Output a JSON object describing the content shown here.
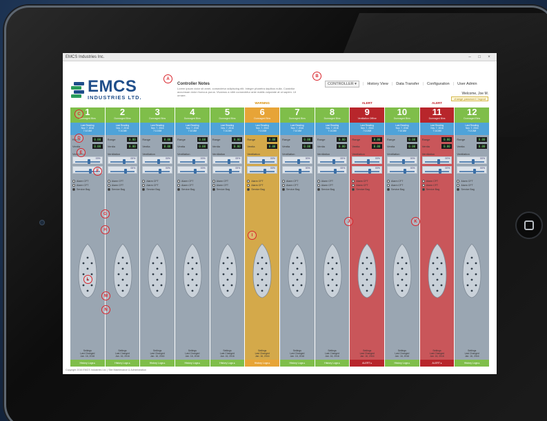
{
  "window": {
    "title": "EMCS Industries Inc.",
    "controls": [
      "–",
      "□",
      "×"
    ]
  },
  "logo": {
    "main": "EMCS",
    "sub": "INDUSTRIES LTD."
  },
  "notes": {
    "title": "Controller Notes",
    "body": "Lorem ipsum dolor sit amet, consectetur adipiscing elit. Integer pharetra dapibus nulla. Curabitur accumsan dolor rhoncus purus. Vivamus a nibh consectetur ante mattis vulputate at ut sapien. Ut ornare."
  },
  "nav": {
    "controller": "CONTROLLER ▾",
    "items": [
      "History View",
      "Data Transfer",
      "Configuration",
      "User Admin"
    ]
  },
  "user": {
    "welcome": "Welcome, Joe M.",
    "logout": "change password / logout"
  },
  "markers": [
    "A",
    "B",
    "C",
    "D",
    "E",
    "F",
    "G",
    "H",
    "I",
    "J",
    "K",
    "L",
    "M",
    "N"
  ],
  "labels": {
    "status_line": "Dunnaged Bins",
    "reading": "Last Reading\nNov. 7, 2016\n7:14 AM",
    "range": "Range",
    "ventia": "Ventia",
    "ventilation": "Ventilation",
    "radios": [
      "Alarm CFT",
      "Alarm CFT",
      "Service Bag"
    ],
    "footer_text": "Settings\nLast Changed\nJan. 16, 2016",
    "footer_btn": "History Logs ▸",
    "alert_btn": "ALERT ▸"
  },
  "channels": [
    {
      "num": "1",
      "status": "Dunnaged Bins",
      "state": "normal",
      "banner": "",
      "v1": "0.00",
      "v2": "0.00",
      "s1": "00%",
      "s2": "00%",
      "fill1": 0.55,
      "fill2": 0.6
    },
    {
      "num": "2",
      "status": "Dunnaged Bins",
      "state": "normal",
      "banner": "",
      "v1": "0.00",
      "v2": "0.00",
      "s1": "00%",
      "s2": "00%",
      "fill1": 0.55,
      "fill2": 0.6
    },
    {
      "num": "3",
      "status": "Dunnaged Bins",
      "state": "normal",
      "banner": "",
      "v1": "0.00",
      "v2": "0.00",
      "s1": "00%",
      "s2": "00%",
      "fill1": 0.55,
      "fill2": 0.6
    },
    {
      "num": "4",
      "status": "Dunnaged Bins",
      "state": "normal",
      "banner": "",
      "v1": "0.00",
      "v2": "0.00",
      "s1": "00%",
      "s2": "00%",
      "fill1": 0.55,
      "fill2": 0.6
    },
    {
      "num": "5",
      "status": "Dunnaged Bins",
      "state": "normal",
      "banner": "",
      "v1": "0.00",
      "v2": "0.00",
      "s1": "00%",
      "s2": "00%",
      "fill1": 0.55,
      "fill2": 0.6
    },
    {
      "num": "6",
      "status": "Dunnaged Bins",
      "state": "warn",
      "banner": "WARNING",
      "v1": "0.00",
      "v2": "0.00",
      "s1": "00%",
      "s2": "00%",
      "fill1": 0.55,
      "fill2": 0.6
    },
    {
      "num": "7",
      "status": "Dunnaged Bins",
      "state": "normal",
      "banner": "",
      "v1": "0.00",
      "v2": "0.00",
      "s1": "00%",
      "s2": "00%",
      "fill1": 0.55,
      "fill2": 0.6
    },
    {
      "num": "8",
      "status": "Dunnaged Bins",
      "state": "normal",
      "banner": "",
      "v1": "0.00",
      "v2": "0.00",
      "s1": "00%",
      "s2": "00%",
      "fill1": 0.55,
      "fill2": 0.6
    },
    {
      "num": "9",
      "status": "Ventilation Offline",
      "state": "alert",
      "banner": "ALERT",
      "v1": "0.00",
      "v2": "0.00",
      "s1": "00%",
      "s2": "00%",
      "fill1": 0.55,
      "fill2": 0.6
    },
    {
      "num": "10",
      "status": "Dunnaged Bins",
      "state": "normal",
      "banner": "",
      "v1": "0.00",
      "v2": "0.00",
      "s1": "00%",
      "s2": "00%",
      "fill1": 0.55,
      "fill2": 0.6
    },
    {
      "num": "11",
      "status": "Dunnaged Bins",
      "state": "alert",
      "banner": "ALERT",
      "v1": "0.00",
      "v2": "0.00",
      "s1": "00%",
      "s2": "00%",
      "fill1": 0.55,
      "fill2": 0.6
    },
    {
      "num": "12",
      "status": "Dunnaged Bins",
      "state": "normal",
      "banner": "",
      "v1": "0.00",
      "v2": "0.00",
      "s1": "00%",
      "s2": "00%",
      "fill1": 0.55,
      "fill2": 0.6
    }
  ],
  "copyright": "Copyright 2016 EMCS Industries Ltd. | Site Maintenance & Administration",
  "colors": {
    "green": "#7fbe4a",
    "blue": "#4fa3d9",
    "warn": "#e7a437",
    "alert": "#b8262b",
    "logo": "#1f4e8a",
    "marker": "#d9232a"
  }
}
